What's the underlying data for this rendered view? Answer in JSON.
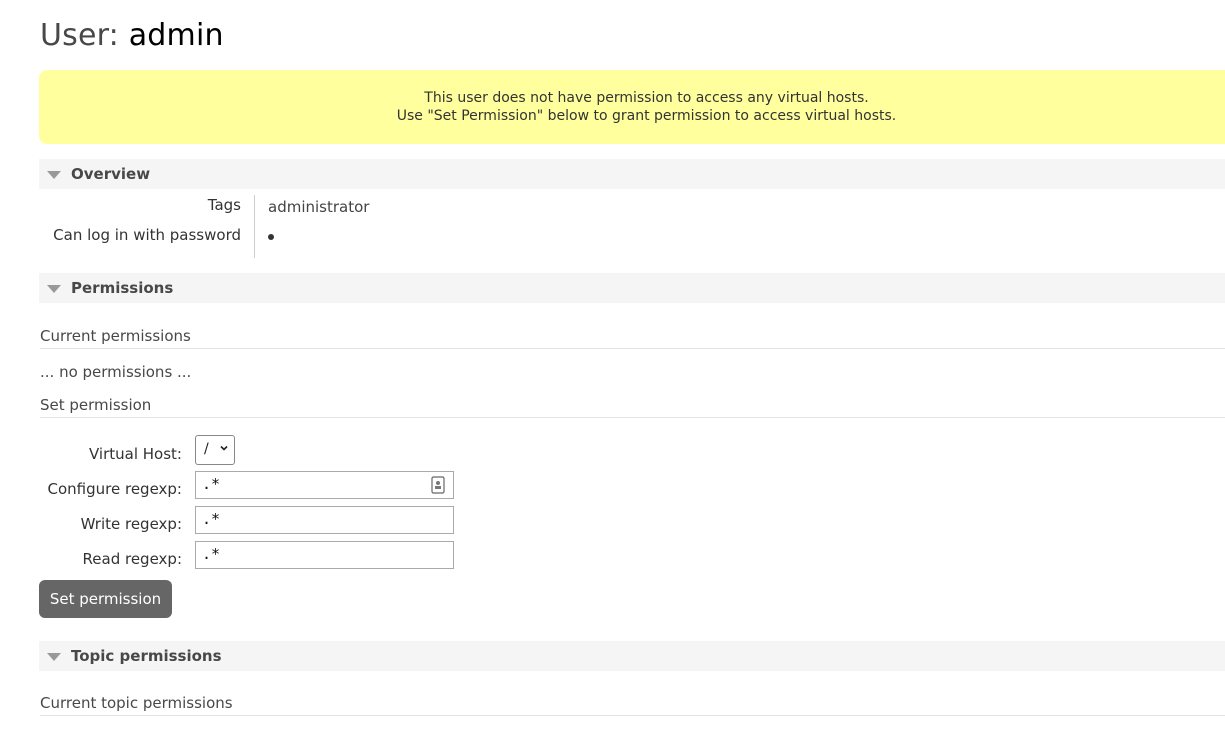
{
  "title": {
    "prefix": "User:",
    "name": "admin"
  },
  "warning": {
    "line1": "This user does not have permission to access any virtual hosts.",
    "line2": "Use \"Set Permission\" below to grant permission to access virtual hosts."
  },
  "overview": {
    "header": "Overview",
    "tags_label": "Tags",
    "tags_value": "administrator",
    "login_label": "Can log in with password",
    "login_value_icon": "bullet-dot"
  },
  "permissions": {
    "header": "Permissions",
    "current_heading": "Current permissions",
    "empty_text": "... no permissions ...",
    "set_heading": "Set permission",
    "vhost_label": "Virtual Host:",
    "vhost_selected": "/",
    "configure_label": "Configure regexp:",
    "configure_value": ".*",
    "write_label": "Write regexp:",
    "write_value": ".*",
    "read_label": "Read regexp:",
    "read_value": ".*",
    "submit_label": "Set permission"
  },
  "topic_permissions": {
    "header": "Topic permissions",
    "current_heading": "Current topic permissions"
  },
  "colors": {
    "warning_bg": "#ffff9e",
    "section_bg": "#f5f5f5",
    "button_bg": "#666666",
    "text": "#484848"
  }
}
